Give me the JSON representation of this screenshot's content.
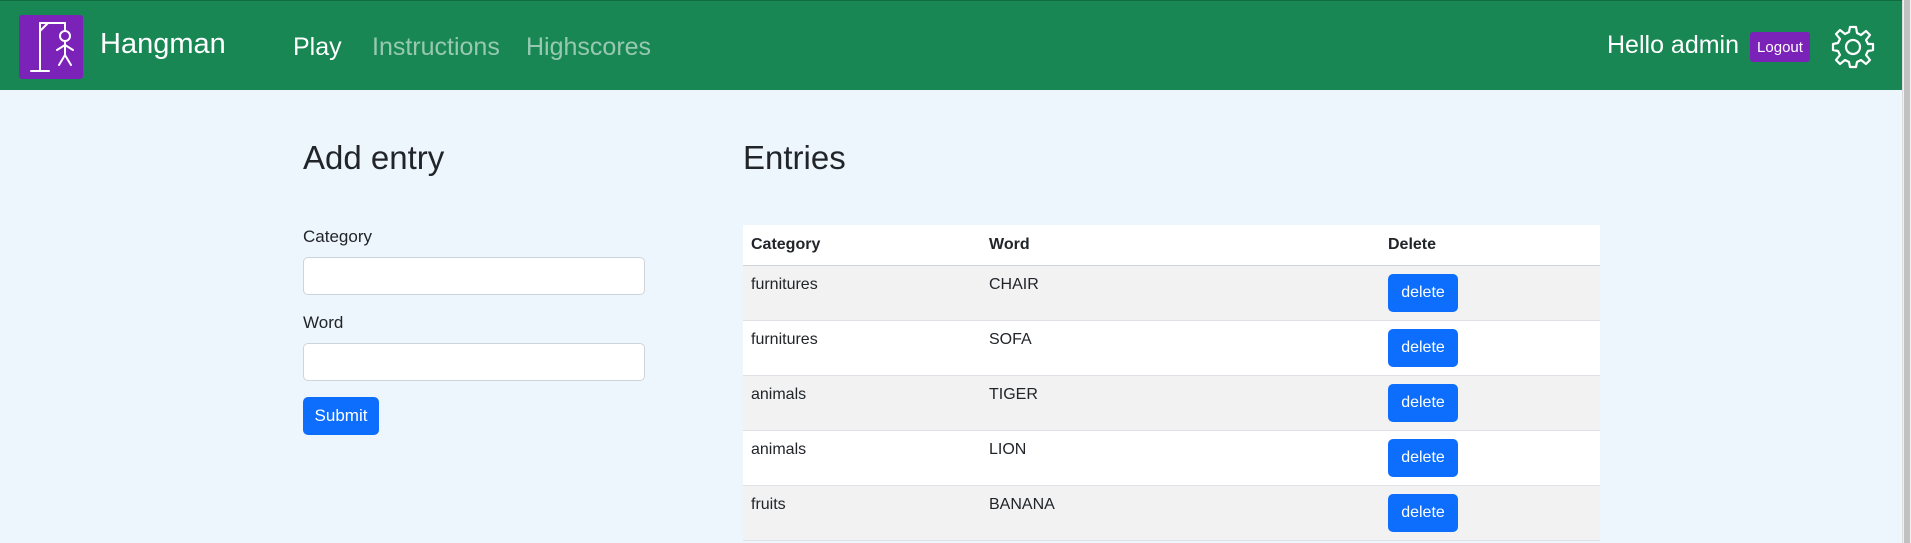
{
  "app": {
    "brand": "Hangman",
    "accent_color": "#198754",
    "logo_color": "#7b22b8",
    "logo_icon": "hangman-icon"
  },
  "nav": {
    "items": [
      {
        "label": "Play",
        "active": true
      },
      {
        "label": "Instructions",
        "active": false
      },
      {
        "label": "Highscores",
        "active": false
      }
    ]
  },
  "user": {
    "greeting": "Hello admin",
    "logout_label": "Logout",
    "settings_icon": "gear-icon"
  },
  "add_entry": {
    "title": "Add entry",
    "category_label": "Category",
    "category_value": "",
    "word_label": "Word",
    "word_value": "",
    "submit_label": "Submit"
  },
  "entries": {
    "title": "Entries",
    "columns": [
      "Category",
      "Word",
      "Delete"
    ],
    "delete_label": "delete",
    "rows": [
      {
        "category": "furnitures",
        "word": "CHAIR"
      },
      {
        "category": "furnitures",
        "word": "SOFA"
      },
      {
        "category": "animals",
        "word": "TIGER"
      },
      {
        "category": "animals",
        "word": "LION"
      },
      {
        "category": "fruits",
        "word": "BANANA"
      }
    ]
  }
}
